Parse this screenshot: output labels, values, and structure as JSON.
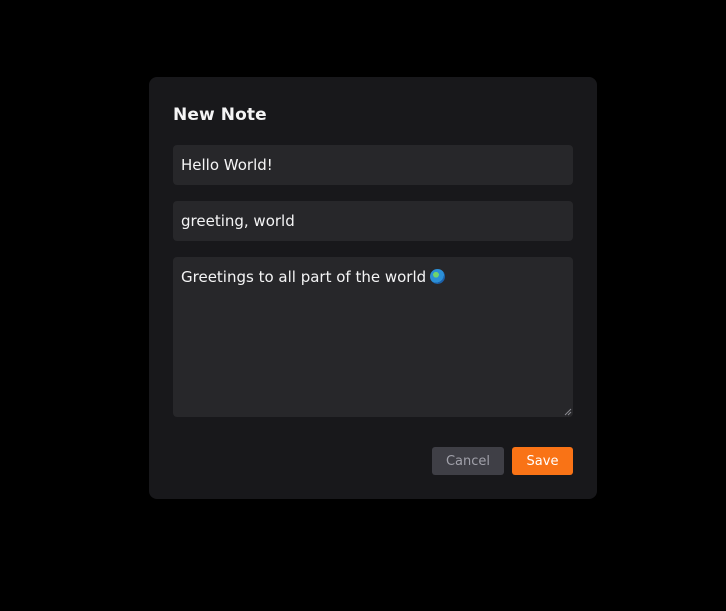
{
  "dialog": {
    "title": "New Note",
    "title_input_value": "Hello World!",
    "tags_input_value": "greeting, world",
    "body_value": "Greetings to all part of the world",
    "body_emoji": "globe-emoji",
    "cancel_label": "Cancel",
    "save_label": "Save"
  },
  "colors": {
    "backdrop": "#000000",
    "dialog_bg": "#18181b",
    "field_bg": "#27272a",
    "cancel_bg": "#3f3f46",
    "save_bg": "#f97316"
  }
}
